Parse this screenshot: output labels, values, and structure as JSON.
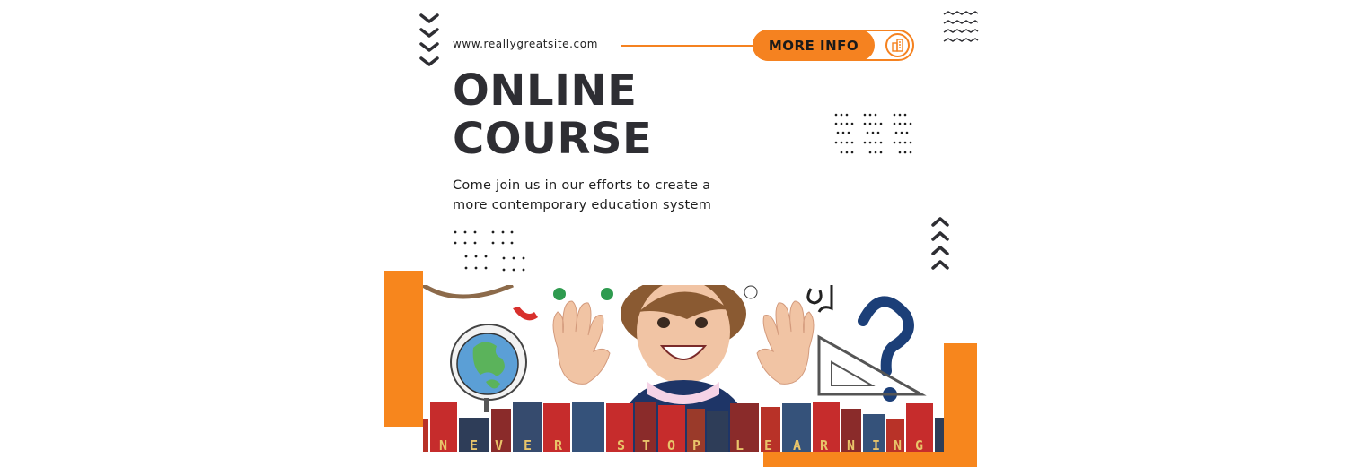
{
  "header": {
    "url": "www.reallygreatsite.com",
    "more_info_label": "MORE INFO"
  },
  "hero": {
    "title_line1": "ONLINE",
    "title_line2": "COURSE",
    "description": "Come join us in our efforts to create a more contemporary education system"
  },
  "photo": {
    "banner_letters": [
      "N",
      "E",
      "V",
      "E",
      "R",
      "S",
      "T",
      "O",
      "P",
      "L",
      "E",
      "A",
      "R",
      "N",
      "I",
      "N",
      "G"
    ]
  },
  "colors": {
    "accent": "#f7861d",
    "text_dark": "#2e2e33"
  },
  "icons": [
    "chevron-down-icon",
    "chevron-up-icon",
    "wavy-lines-icon",
    "building-icon",
    "dot-grid"
  ]
}
